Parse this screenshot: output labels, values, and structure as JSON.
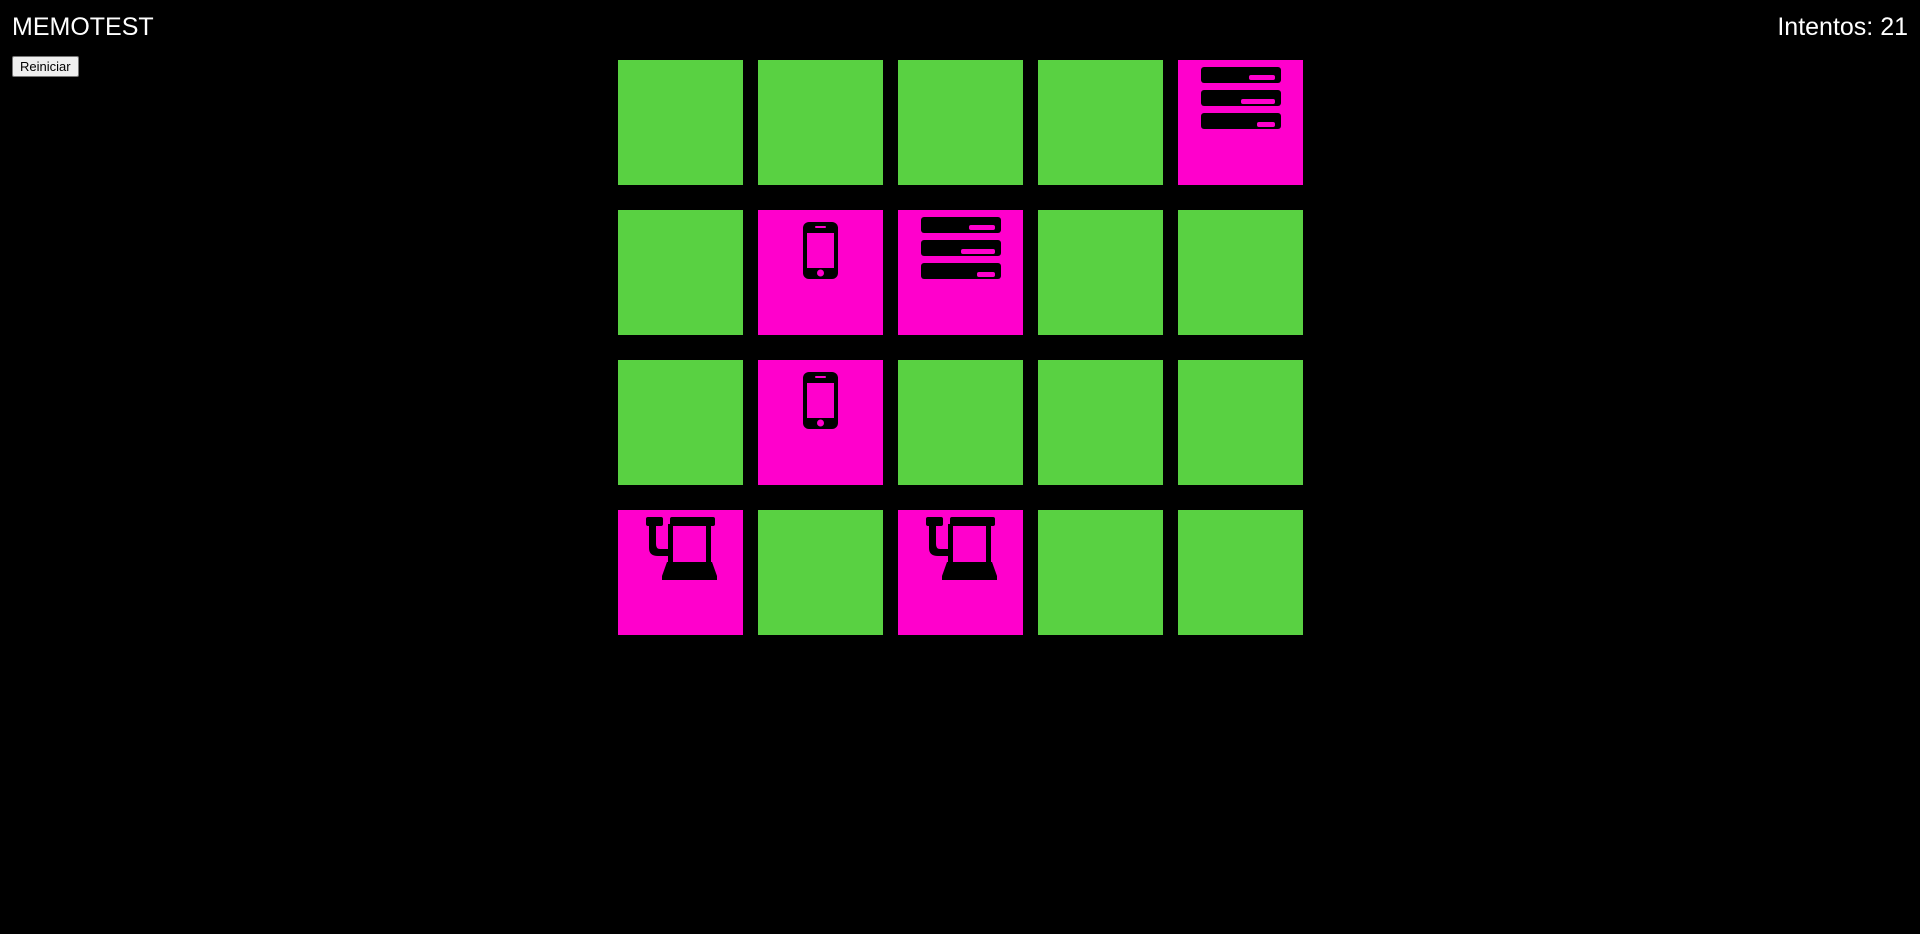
{
  "header": {
    "title": "MEMOTEST",
    "attempts_label": "Intentos: 21"
  },
  "controls": {
    "restart_label": "Reiniciar"
  },
  "colors": {
    "background": "#000000",
    "card_hidden": "#59d142",
    "card_revealed": "#ff00cc",
    "icon": "#000000"
  },
  "board": {
    "columns": 5,
    "rows": 4,
    "cards": [
      {
        "state": "hidden",
        "icon": ""
      },
      {
        "state": "hidden",
        "icon": ""
      },
      {
        "state": "hidden",
        "icon": ""
      },
      {
        "state": "hidden",
        "icon": ""
      },
      {
        "state": "revealed",
        "icon": "server-icon"
      },
      {
        "state": "hidden",
        "icon": ""
      },
      {
        "state": "revealed",
        "icon": "smartphone-icon"
      },
      {
        "state": "revealed",
        "icon": "server-icon"
      },
      {
        "state": "hidden",
        "icon": ""
      },
      {
        "state": "hidden",
        "icon": ""
      },
      {
        "state": "hidden",
        "icon": ""
      },
      {
        "state": "revealed",
        "icon": "smartphone-icon"
      },
      {
        "state": "hidden",
        "icon": ""
      },
      {
        "state": "hidden",
        "icon": ""
      },
      {
        "state": "hidden",
        "icon": ""
      },
      {
        "state": "revealed",
        "icon": "beer-mug-icon"
      },
      {
        "state": "hidden",
        "icon": ""
      },
      {
        "state": "revealed",
        "icon": "beer-mug-icon"
      },
      {
        "state": "hidden",
        "icon": ""
      },
      {
        "state": "hidden",
        "icon": ""
      }
    ]
  }
}
